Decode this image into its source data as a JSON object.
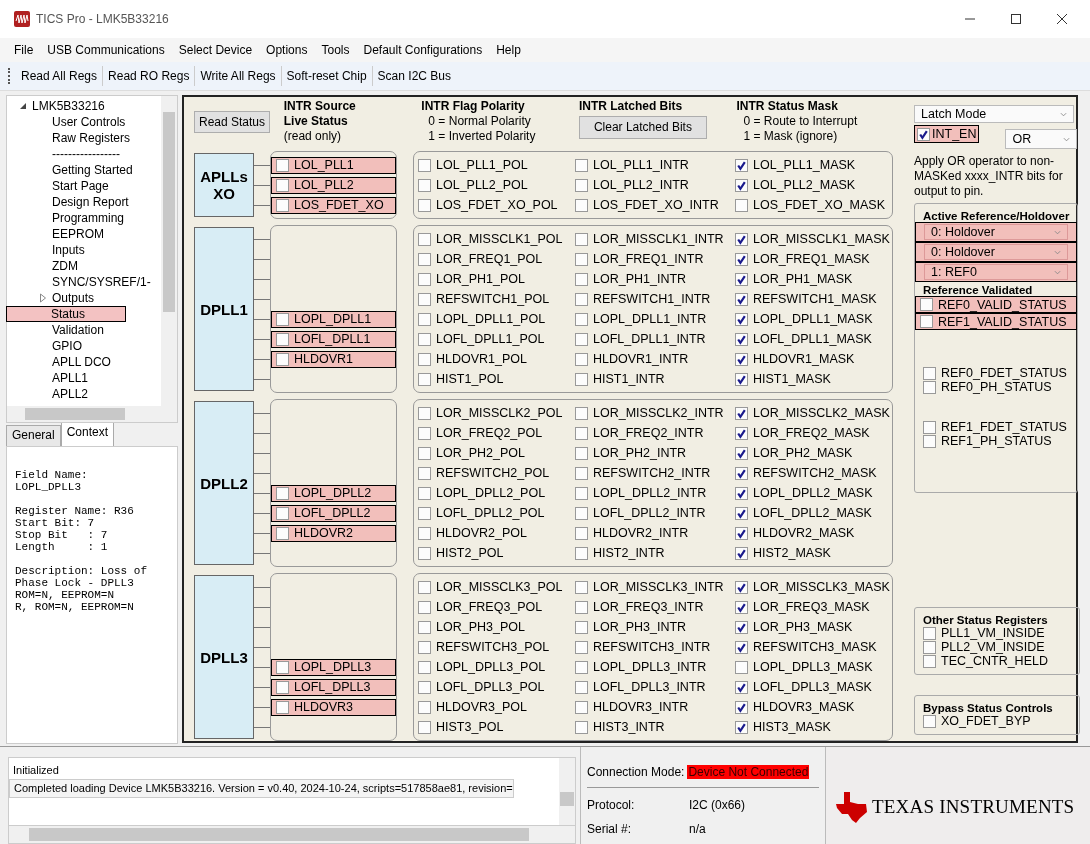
{
  "window": {
    "title": "TICS Pro - LMK5B33216"
  },
  "menu": [
    "File",
    "USB Communications",
    "Select Device",
    "Options",
    "Tools",
    "Default Configurations",
    "Help"
  ],
  "toolbar": [
    "Read All Regs",
    "Read RO Regs",
    "Write All Regs",
    "Soft-reset Chip",
    "Scan I2C Bus"
  ],
  "tree": {
    "label": "LMK5B33216",
    "expanded": true,
    "children": [
      {
        "label": "User Controls",
        "selected": false,
        "expandable": false
      },
      {
        "label": "Raw Registers",
        "selected": false,
        "expandable": false
      },
      {
        "label": "-----------------",
        "selected": false,
        "expandable": false
      },
      {
        "label": "Getting Started",
        "selected": false,
        "expandable": false
      },
      {
        "label": "Start Page",
        "selected": false,
        "expandable": false
      },
      {
        "label": "Design Report",
        "selected": false,
        "expandable": false
      },
      {
        "label": "Programming",
        "selected": false,
        "expandable": false
      },
      {
        "label": "EEPROM",
        "selected": false,
        "expandable": false
      },
      {
        "label": "Inputs",
        "selected": false,
        "expandable": false
      },
      {
        "label": "ZDM",
        "selected": false,
        "expandable": false
      },
      {
        "label": "SYNC/SYSREF/1-",
        "selected": false,
        "expandable": false
      },
      {
        "label": "Outputs",
        "selected": false,
        "expandable": true
      },
      {
        "label": "Status",
        "selected": true,
        "expandable": false
      },
      {
        "label": "Validation",
        "selected": false,
        "expandable": false
      },
      {
        "label": "GPIO",
        "selected": false,
        "expandable": false
      },
      {
        "label": "APLL DCO",
        "selected": false,
        "expandable": false
      },
      {
        "label": "APLL1",
        "selected": false,
        "expandable": false
      },
      {
        "label": "APLL2",
        "selected": false,
        "expandable": false
      }
    ]
  },
  "info_tabs": [
    {
      "label": "General",
      "selected": false
    },
    {
      "label": "Context",
      "selected": true
    }
  ],
  "context_paragraphs": [
    [
      "Field Name:",
      "LOPL_DPLL3"
    ],
    [
      "Register Name: R36",
      "Start Bit: 7",
      "Stop Bit   : 7",
      "Length     : 1"
    ],
    [
      "Description: Loss of",
      "Phase Lock - DPLL3",
      "ROM=N, EEPROM=N",
      "R, ROM=N, EEPROM=N"
    ]
  ],
  "main": {
    "read_status_button": "Read Status",
    "headers": {
      "source": [
        "INTR Source",
        "Live Status",
        "(read only)"
      ],
      "polarity": [
        "INTR Flag Polarity",
        "0 = Normal Polarity",
        "1 = Inverted Polarity"
      ],
      "latched": {
        "title": "INTR Latched Bits",
        "button": "Clear Latched Bits"
      },
      "mask": [
        "INTR Status Mask",
        "0 = Route to Interrupt",
        "1 = Mask (ignore)"
      ]
    },
    "groups": [
      {
        "label": "APLLs XO",
        "rows": [
          {
            "source": {
              "label": "LOL_PLL1",
              "checked": false,
              "highlighted": true
            },
            "pol": {
              "label": "LOL_PLL1_POL",
              "checked": false
            },
            "intr": {
              "label": "LOL_PLL1_INTR",
              "checked": false
            },
            "mask": {
              "label": "LOL_PLL1_MASK",
              "checked": true
            }
          },
          {
            "source": {
              "label": "LOL_PLL2",
              "checked": false,
              "highlighted": true
            },
            "pol": {
              "label": "LOL_PLL2_POL",
              "checked": false
            },
            "intr": {
              "label": "LOL_PLL2_INTR",
              "checked": false
            },
            "mask": {
              "label": "LOL_PLL2_MASK",
              "checked": true
            }
          },
          {
            "source": {
              "label": "LOS_FDET_XO",
              "checked": false,
              "highlighted": true
            },
            "pol": {
              "label": "LOS_FDET_XO_POL",
              "checked": false
            },
            "intr": {
              "label": "LOS_FDET_XO_INTR",
              "checked": false
            },
            "mask": {
              "label": "LOS_FDET_XO_MASK",
              "checked": false
            }
          }
        ]
      },
      {
        "label": "DPLL1",
        "rows": [
          {
            "pol": {
              "label": "LOR_MISSCLK1_POL",
              "checked": false
            },
            "intr": {
              "label": "LOR_MISSCLK1_INTR",
              "checked": false
            },
            "mask": {
              "label": "LOR_MISSCLK1_MASK",
              "checked": true
            }
          },
          {
            "pol": {
              "label": "LOR_FREQ1_POL",
              "checked": false
            },
            "intr": {
              "label": "LOR_FREQ1_INTR",
              "checked": false
            },
            "mask": {
              "label": "LOR_FREQ1_MASK",
              "checked": true
            }
          },
          {
            "pol": {
              "label": "LOR_PH1_POL",
              "checked": false
            },
            "intr": {
              "label": "LOR_PH1_INTR",
              "checked": false
            },
            "mask": {
              "label": "LOR_PH1_MASK",
              "checked": true
            }
          },
          {
            "pol": {
              "label": "REFSWITCH1_POL",
              "checked": false
            },
            "intr": {
              "label": "REFSWITCH1_INTR",
              "checked": false
            },
            "mask": {
              "label": "REFSWITCH1_MASK",
              "checked": true
            }
          },
          {
            "source": {
              "label": "LOPL_DPLL1",
              "checked": false,
              "highlighted": true
            },
            "pol": {
              "label": "LOPL_DPLL1_POL",
              "checked": false
            },
            "intr": {
              "label": "LOPL_DPLL1_INTR",
              "checked": false
            },
            "mask": {
              "label": "LOPL_DPLL1_MASK",
              "checked": true
            }
          },
          {
            "source": {
              "label": "LOFL_DPLL1",
              "checked": false,
              "highlighted": true
            },
            "pol": {
              "label": "LOFL_DPLL1_POL",
              "checked": false
            },
            "intr": {
              "label": "LOFL_DPLL1_INTR",
              "checked": false
            },
            "mask": {
              "label": "LOFL_DPLL1_MASK",
              "checked": true
            }
          },
          {
            "source": {
              "label": "HLDOVR1",
              "checked": false,
              "highlighted": true
            },
            "pol": {
              "label": "HLDOVR1_POL",
              "checked": false
            },
            "intr": {
              "label": "HLDOVR1_INTR",
              "checked": false
            },
            "mask": {
              "label": "HLDOVR1_MASK",
              "checked": true
            }
          },
          {
            "pol": {
              "label": "HIST1_POL",
              "checked": false
            },
            "intr": {
              "label": "HIST1_INTR",
              "checked": false
            },
            "mask": {
              "label": "HIST1_MASK",
              "checked": true
            }
          }
        ]
      },
      {
        "label": "DPLL2",
        "rows": [
          {
            "pol": {
              "label": "LOR_MISSCLK2_POL",
              "checked": false
            },
            "intr": {
              "label": "LOR_MISSCLK2_INTR",
              "checked": false
            },
            "mask": {
              "label": "LOR_MISSCLK2_MASK",
              "checked": true
            }
          },
          {
            "pol": {
              "label": "LOR_FREQ2_POL",
              "checked": false
            },
            "intr": {
              "label": "LOR_FREQ2_INTR",
              "checked": false
            },
            "mask": {
              "label": "LOR_FREQ2_MASK",
              "checked": true
            }
          },
          {
            "pol": {
              "label": "LOR_PH2_POL",
              "checked": false
            },
            "intr": {
              "label": "LOR_PH2_INTR",
              "checked": false
            },
            "mask": {
              "label": "LOR_PH2_MASK",
              "checked": true
            }
          },
          {
            "pol": {
              "label": "REFSWITCH2_POL",
              "checked": false
            },
            "intr": {
              "label": "REFSWITCH2_INTR",
              "checked": false
            },
            "mask": {
              "label": "REFSWITCH2_MASK",
              "checked": true
            }
          },
          {
            "source": {
              "label": "LOPL_DPLL2",
              "checked": false,
              "highlighted": true
            },
            "pol": {
              "label": "LOPL_DPLL2_POL",
              "checked": false
            },
            "intr": {
              "label": "LOPL_DPLL2_INTR",
              "checked": false
            },
            "mask": {
              "label": "LOPL_DPLL2_MASK",
              "checked": true
            }
          },
          {
            "source": {
              "label": "LOFL_DPLL2",
              "checked": false,
              "highlighted": true
            },
            "pol": {
              "label": "LOFL_DPLL2_POL",
              "checked": false
            },
            "intr": {
              "label": "LOFL_DPLL2_INTR",
              "checked": false
            },
            "mask": {
              "label": "LOFL_DPLL2_MASK",
              "checked": true
            }
          },
          {
            "source": {
              "label": "HLDOVR2",
              "checked": false,
              "highlighted": true
            },
            "pol": {
              "label": "HLDOVR2_POL",
              "checked": false
            },
            "intr": {
              "label": "HLDOVR2_INTR",
              "checked": false
            },
            "mask": {
              "label": "HLDOVR2_MASK",
              "checked": true
            }
          },
          {
            "pol": {
              "label": "HIST2_POL",
              "checked": false
            },
            "intr": {
              "label": "HIST2_INTR",
              "checked": false
            },
            "mask": {
              "label": "HIST2_MASK",
              "checked": true
            }
          }
        ]
      },
      {
        "label": "DPLL3",
        "rows": [
          {
            "pol": {
              "label": "LOR_MISSCLK3_POL",
              "checked": false
            },
            "intr": {
              "label": "LOR_MISSCLK3_INTR",
              "checked": false
            },
            "mask": {
              "label": "LOR_MISSCLK3_MASK",
              "checked": true
            }
          },
          {
            "pol": {
              "label": "LOR_FREQ3_POL",
              "checked": false
            },
            "intr": {
              "label": "LOR_FREQ3_INTR",
              "checked": false
            },
            "mask": {
              "label": "LOR_FREQ3_MASK",
              "checked": true
            }
          },
          {
            "pol": {
              "label": "LOR_PH3_POL",
              "checked": false
            },
            "intr": {
              "label": "LOR_PH3_INTR",
              "checked": false
            },
            "mask": {
              "label": "LOR_PH3_MASK",
              "checked": true
            }
          },
          {
            "pol": {
              "label": "REFSWITCH3_POL",
              "checked": false
            },
            "intr": {
              "label": "REFSWITCH3_INTR",
              "checked": false
            },
            "mask": {
              "label": "REFSWITCH3_MASK",
              "checked": true
            }
          },
          {
            "source": {
              "label": "LOPL_DPLL3",
              "checked": false,
              "highlighted": true
            },
            "pol": {
              "label": "LOPL_DPLL3_POL",
              "checked": false
            },
            "intr": {
              "label": "LOPL_DPLL3_INTR",
              "checked": false
            },
            "mask": {
              "label": "LOPL_DPLL3_MASK",
              "checked": false
            }
          },
          {
            "source": {
              "label": "LOFL_DPLL3",
              "checked": false,
              "highlighted": true
            },
            "pol": {
              "label": "LOFL_DPLL3_POL",
              "checked": false
            },
            "intr": {
              "label": "LOFL_DPLL3_INTR",
              "checked": false
            },
            "mask": {
              "label": "LOFL_DPLL3_MASK",
              "checked": true
            }
          },
          {
            "source": {
              "label": "HLDOVR3",
              "checked": false,
              "highlighted": true
            },
            "pol": {
              "label": "HLDOVR3_POL",
              "checked": false
            },
            "intr": {
              "label": "HLDOVR3_INTR",
              "checked": false
            },
            "mask": {
              "label": "HLDOVR3_MASK",
              "checked": true
            }
          },
          {
            "pol": {
              "label": "HIST3_POL",
              "checked": false
            },
            "intr": {
              "label": "HIST3_INTR",
              "checked": false
            },
            "mask": {
              "label": "HIST3_MASK",
              "checked": true
            }
          }
        ]
      }
    ]
  },
  "side": {
    "latch_mode": "Latch Mode",
    "int_en": {
      "label": "INT_EN",
      "checked": true,
      "highlighted": true
    },
    "operator": "OR",
    "operator_note": "Apply OR operator to non-MASKed xxxx_INTR bits for output to pin.",
    "active_reference": {
      "title": "Active Reference/Holdover",
      "selects": [
        {
          "value": "0: Holdover",
          "highlighted": true
        },
        {
          "value": "0: Holdover",
          "highlighted": true
        },
        {
          "value": "1: REF0",
          "highlighted": true
        }
      ]
    },
    "reference_validated": {
      "title": "Reference Validated",
      "items": [
        {
          "label": "REF0_VALID_STATUS",
          "checked": false,
          "highlighted": true
        },
        {
          "label": "REF1_VALID_STATUS",
          "checked": false,
          "highlighted": true
        }
      ]
    },
    "ref_status": [
      {
        "items": [
          {
            "label": "REF0_FDET_STATUS",
            "checked": false
          },
          {
            "label": "REF0_PH_STATUS",
            "checked": false
          }
        ]
      },
      {
        "items": [
          {
            "label": "REF1_FDET_STATUS",
            "checked": false
          },
          {
            "label": "REF1_PH_STATUS",
            "checked": false
          }
        ]
      }
    ],
    "other_status": {
      "title": "Other Status Registers",
      "items": [
        {
          "label": "PLL1_VM_INSIDE",
          "checked": false
        },
        {
          "label": "PLL2_VM_INSIDE",
          "checked": false
        },
        {
          "label": "TEC_CNTR_HELD",
          "checked": false
        }
      ]
    },
    "bypass": {
      "title": "Bypass Status Controls",
      "items": [
        {
          "label": "XO_FDET_BYP",
          "checked": false
        }
      ]
    }
  },
  "log": [
    {
      "text": "Initialized",
      "selected": false
    },
    {
      "text": "Completed loading Device LMK5B33216. Version = v0.40, 2024-10-24, scripts=517858ae81, revision=",
      "selected": true
    }
  ],
  "connection": {
    "label": "Connection Mode:",
    "status": "Device Not Connected",
    "connected": false,
    "protocol_label": "Protocol:",
    "protocol": "I2C (0x66)",
    "serial_label": "Serial #:",
    "serial": "n/a"
  },
  "brand": "TEXAS INSTRUMENTS"
}
